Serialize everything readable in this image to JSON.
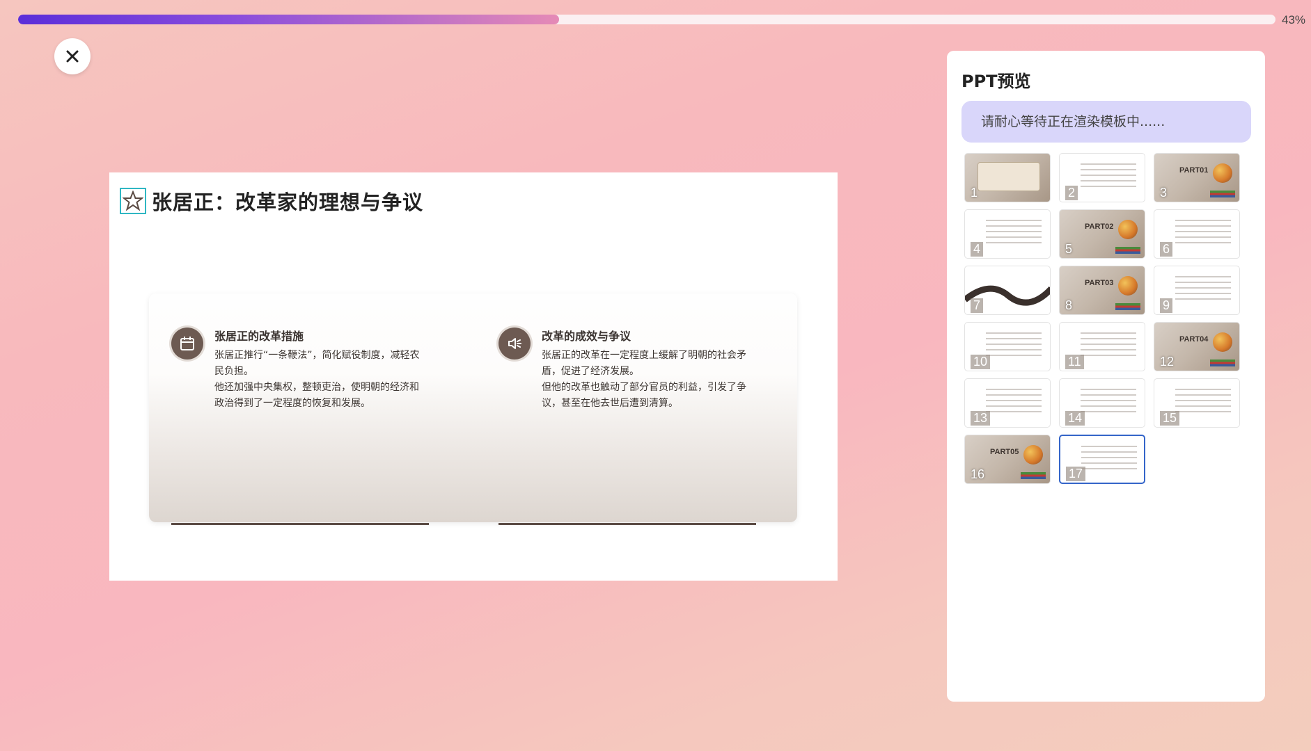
{
  "progress": {
    "percent": 43,
    "label": "43%"
  },
  "close": {
    "icon": "close-icon"
  },
  "slide": {
    "title": "张居正：改革家的理想与争议",
    "title_icon": "star-icon",
    "columns": [
      {
        "icon": "calendar-icon",
        "title": "张居正的改革措施",
        "text": "张居正推行“一条鞭法”，简化赋役制度，减轻农民负担。\n他还加强中央集权，整顿吏治，使明朝的经济和政治得到了一定程度的恢复和发展。"
      },
      {
        "icon": "speaker-icon",
        "title": "改革的成效与争议",
        "text": "张居正的改革在一定程度上缓解了明朝的社会矛盾，促进了经济发展。\n但他的改革也触动了部分官员的利益，引发了争议，甚至在他去世后遭到清算。"
      }
    ]
  },
  "preview": {
    "title": "PPT预览",
    "notice": "请耐心等待正在渲染模板中......",
    "selected": 17,
    "thumbnails": [
      {
        "num": "1",
        "style": "photo",
        "part": ""
      },
      {
        "num": "2",
        "style": "white",
        "part": ""
      },
      {
        "num": "3",
        "style": "photo",
        "part": "PART01"
      },
      {
        "num": "4",
        "style": "white",
        "part": ""
      },
      {
        "num": "5",
        "style": "photo",
        "part": "PART02"
      },
      {
        "num": "6",
        "style": "white",
        "part": ""
      },
      {
        "num": "7",
        "style": "white",
        "part": ""
      },
      {
        "num": "8",
        "style": "photo",
        "part": "PART03"
      },
      {
        "num": "9",
        "style": "white",
        "part": ""
      },
      {
        "num": "10",
        "style": "white",
        "part": ""
      },
      {
        "num": "11",
        "style": "white",
        "part": ""
      },
      {
        "num": "12",
        "style": "photo",
        "part": "PART04"
      },
      {
        "num": "13",
        "style": "white",
        "part": ""
      },
      {
        "num": "14",
        "style": "white",
        "part": ""
      },
      {
        "num": "15",
        "style": "white",
        "part": ""
      },
      {
        "num": "16",
        "style": "photo",
        "part": "PART05"
      },
      {
        "num": "17",
        "style": "white",
        "part": ""
      }
    ]
  },
  "colors": {
    "accent": "#5b2ed9",
    "selection": "#3465c9",
    "notice_bg": "#d9d6fa",
    "slide_brown": "#6d5a52"
  }
}
